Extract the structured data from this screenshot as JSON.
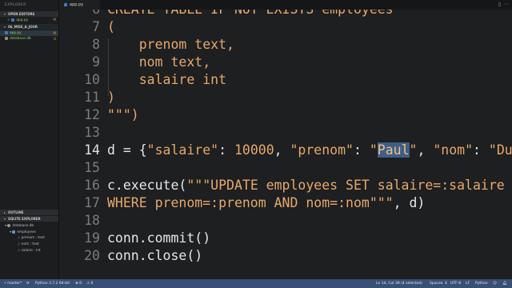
{
  "sidebar": {
    "title": "EXPLORER",
    "open_editors_label": "OPEN EDITORS",
    "open_editors": [
      {
        "name": "app.py",
        "badge": "M"
      }
    ],
    "folder_label": "06_MISE_A_JOUR",
    "files": [
      {
        "name": "app.py",
        "badge": "M"
      },
      {
        "name": "database.db",
        "badge": "U"
      }
    ],
    "outline_label": "OUTLINE",
    "sqlite_label": "SQLITE EXPLORER",
    "db_name": "database.db",
    "table_name": "employees",
    "columns": [
      "prenom : text",
      "nom : text",
      "salaire : int"
    ]
  },
  "tab": {
    "label": "app.py"
  },
  "editor": {
    "lines": [
      {
        "n": "6",
        "text": "CREATE TABLE IF NOT EXISTS employees"
      },
      {
        "n": "7",
        "text": "("
      },
      {
        "n": "8",
        "text": "    prenom text,"
      },
      {
        "n": "9",
        "text": "    nom text,"
      },
      {
        "n": "10",
        "text": "    salaire int"
      },
      {
        "n": "11",
        "text": ")"
      },
      {
        "n": "12",
        "text": "\"\"\")"
      },
      {
        "n": "13",
        "text": ""
      },
      {
        "n": "14",
        "a": "d = {",
        "b": "\"salaire\"",
        "c": ": ",
        "d": "10000",
        "e": ", ",
        "f": "\"prenom\"",
        "g": ": ",
        "h": "\"",
        "sel": "Paul",
        "i": "\"",
        "j": ", ",
        "k": "\"nom\"",
        "l": ": ",
        "m": "\"Dupont\"",
        "o": "}"
      },
      {
        "n": "15",
        "text": ""
      },
      {
        "n": "16",
        "a": "c.execute(",
        "b": "\"\"\"UPDATE employees SET salaire=:salaire"
      },
      {
        "n": "17",
        "text": "WHERE prenom=:prenom AND nom=:nom\"\"\"",
        "tail": ", d)"
      },
      {
        "n": "18",
        "text": ""
      },
      {
        "n": "19",
        "text": "conn.commit()"
      },
      {
        "n": "20",
        "text": "conn.close()"
      }
    ]
  },
  "statusbar": {
    "branch": "master*",
    "sync": "⟳",
    "python": "Python 3.7.2 64-bit",
    "errors": "⊗ 0",
    "warnings": "⚠ 0",
    "cursor": "Ln 14, Col 39 (4 selected)",
    "spaces": "Spaces: 4",
    "encoding": "UTF-8",
    "eol": "LF",
    "language": "Python"
  },
  "colors": {
    "status_bg": "#3a4f75",
    "string": "#e8a86a",
    "selection": "#3e5e86"
  }
}
